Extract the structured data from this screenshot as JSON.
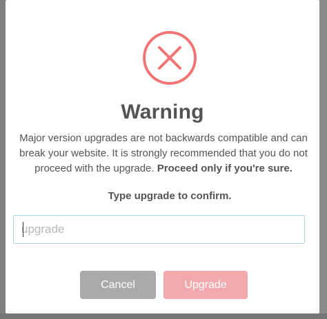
{
  "dialog": {
    "title": "Warning",
    "message": "Major version upgrades are not backwards compatible and can break your website. It is strongly recommended that you do not proceed with the upgrade. ",
    "message_emphasis": "Proceed only if you're sure.",
    "confirm_label": "Type upgrade to confirm.",
    "input": {
      "value": "",
      "placeholder": "upgrade"
    },
    "buttons": {
      "cancel": "Cancel",
      "upgrade": "Upgrade"
    },
    "icon": "error-x-circle-icon"
  },
  "colors": {
    "icon_stroke": "#f27474",
    "title": "#545454",
    "cancel_bg": "#aaaaaa",
    "upgrade_bg": "#f1a9ae",
    "input_border": "#a9d3ea"
  }
}
